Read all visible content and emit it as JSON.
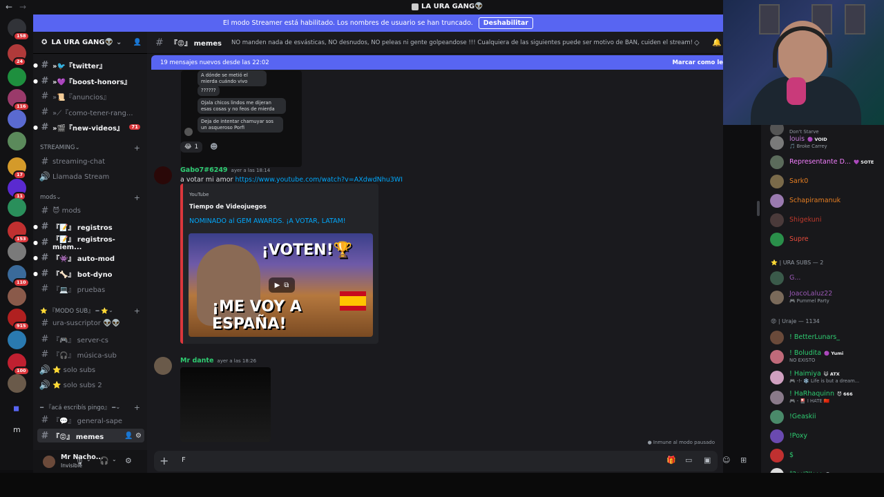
{
  "window": {
    "title": "LA URA GANG👽",
    "back": "←",
    "forward": "→"
  },
  "banner": {
    "text": "El modo Streamer está habilitado. Los nombres de usuario se han truncado.",
    "button": "Deshabilitar"
  },
  "guilds": [
    {
      "badge": "158",
      "color": "#313338"
    },
    {
      "badge": "24",
      "color": "#b03a3a"
    },
    {
      "badge": "",
      "color": "#1e8f3e"
    },
    {
      "badge": "116",
      "color": "#9a3a6a"
    },
    {
      "badge": "",
      "color": "#5a6ad0"
    },
    {
      "badge": "",
      "color": "#5b8a5b"
    },
    {
      "badge": "17",
      "color": "#d49a2a"
    },
    {
      "badge": "11",
      "color": "#5a2ad0"
    },
    {
      "badge": "",
      "color": "#2a8f5b"
    },
    {
      "badge": "153",
      "color": "#c03030"
    },
    {
      "badge": "",
      "color": "#7a7a7a"
    },
    {
      "badge": "110",
      "color": "#3a6a9a"
    },
    {
      "badge": "",
      "color": "#8a5a4a"
    },
    {
      "badge": "915",
      "color": "#b02020"
    },
    {
      "badge": "",
      "color": "#2a7ab0"
    },
    {
      "badge": "100",
      "color": "#c02030"
    },
    {
      "badge": "",
      "color": "#6a5a4a"
    }
  ],
  "guild_folder_label": "m",
  "server": {
    "name": "LA URA GANG👽"
  },
  "channels": [
    {
      "label": "»🐦『twitter』",
      "bold": true,
      "arrow": true
    },
    {
      "label": "»💜『boost-honors』",
      "bold": true,
      "arrow": true
    },
    {
      "label": "»📜『anuncios』",
      "bold": false,
      "arrow": true
    },
    {
      "label": "»⟋『como-tener-rang...",
      "bold": false,
      "arrow": true
    },
    {
      "label": "»🎬『new-videos』",
      "bold": true,
      "arrow": true,
      "badge": "71"
    }
  ],
  "cat_streaming": "STREAMING",
  "streaming": [
    {
      "label": "streaming-chat",
      "icon": "#"
    },
    {
      "label": "Llamada Stream",
      "icon": "🔊"
    }
  ],
  "cat_mods": "mods",
  "mods": [
    {
      "label": "😈 mods",
      "bold": false
    },
    {
      "label": "『📝』 registros",
      "bold": true
    },
    {
      "label": "『📝』 registros-miem...",
      "bold": true
    },
    {
      "label": "『👾』 auto-mod",
      "bold": true
    },
    {
      "label": "『🦴』 bot-dyno",
      "bold": true
    },
    {
      "label": "『💻』 pruebas",
      "bold": false
    }
  ],
  "cat_sub": "⭐ 『MODO SUB』 ━ ⭐",
  "sub": [
    {
      "label": "ura-suscriptor 👽👽",
      "icon": "#"
    },
    {
      "label": "『🎮』 server-cs",
      "icon": "#"
    },
    {
      "label": "『🎧』 música-sub",
      "icon": "#"
    },
    {
      "label": "⭐ solo subs",
      "icon": "🔊"
    },
    {
      "label": "⭐ solo subs 2",
      "icon": "🔊"
    }
  ],
  "cat_pingo": "━ 『acá escribís pingo』 ━",
  "pingo": [
    {
      "label": "『💬』 general-sape",
      "selected": false
    },
    {
      "label": "『😡』 memes",
      "selected": true
    }
  ],
  "user": {
    "name": "Mr Nacho...",
    "status": "Invisible"
  },
  "chat": {
    "channel": "『😡』 memes",
    "topic": "NO manden nada de esvásticas, NO desnudos, NO peleas ni gente golpeandose !!! Cualquiera de las siguientes puede ser motivo de BAN, cuiden el stream!",
    "new_messages": "19 mensajes nuevos desde las 22:02",
    "mark_read": "Marcar como le",
    "bubbles": [
      "A dónde se metió el mierda cuándo vivo",
      "??????",
      "Ojala chicos lindos me dijeran esas cosas y no feos de mierda",
      "Deja de intentar chamuyar sos un asqueroso Porfi"
    ],
    "reaction_count": "1",
    "msg1": {
      "author": "Gabo7#6249",
      "time": "ayer a las 18:14",
      "text": "a votar mi amor ",
      "link": "https://www.youtube.com/watch?v=AXdwdNhu3WI"
    },
    "embed": {
      "provider": "YouTube",
      "title": "Tiempo de Videojuegos",
      "link": "NOMINADO al GEM AWARDS. ¡A VOTAR, LATAM!",
      "thumb_top": "¡VOTEN!🏆",
      "thumb_bottom": "¡ME VOY A ESPAÑA!"
    },
    "msg2": {
      "author": "Mr dante",
      "time": "ayer a las 18:26"
    },
    "immune": "Inmune al modo pausado",
    "input_value": "F"
  },
  "members": {
    "top_partial": "Don't Starve",
    "group1": [
      {
        "name": "louis",
        "color": "#c27cd6",
        "tag": "🟣 VOID",
        "sub": "🎵 Broke Carrey",
        "av": "#7a7a7a"
      },
      {
        "name": "Representante D...",
        "color": "#f47fff",
        "tag": "💜 SOTE",
        "sub": "",
        "av": "#5b6b5b"
      },
      {
        "name": "Sark0",
        "color": "#e67e22",
        "tag": "",
        "sub": "",
        "av": "#7a6a4a"
      },
      {
        "name": "Schapiramanuk",
        "color": "#e67e22",
        "tag": "",
        "sub": "",
        "av": "#9a7ab0"
      },
      {
        "name": "Shigekuni",
        "color": "#c0392b",
        "tag": "",
        "sub": "",
        "av": "#4a3a3a"
      },
      {
        "name": "Supre",
        "color": "#e74c3c",
        "tag": "",
        "sub": "",
        "av": "#2a8f4a"
      }
    ],
    "cat_subs": "⭐ | URA SUBS — 2",
    "group2": [
      {
        "name": "G...",
        "color": "#9b59b6",
        "tag": "",
        "sub": "",
        "av": "#3a5a4a"
      },
      {
        "name": "JoacoLaluz22",
        "color": "#9b59b6",
        "tag": "",
        "sub": "🎮 Pummel Party",
        "av": "#7a6a5a"
      }
    ],
    "cat_uraje": "😡 | Uraje — 1134",
    "group3": [
      {
        "name": "! BetterLunars_",
        "color": "#2ecc71",
        "tag": "",
        "sub": "",
        "av": "#6a4a3a"
      },
      {
        "name": "! Boludita",
        "color": "#2ecc71",
        "tag": "🟣 Yumi",
        "sub": "NO EXISTO",
        "av": "#c06a7a"
      },
      {
        "name": "! Haimiya",
        "color": "#2ecc71",
        "tag": "😺 ATX",
        "sub": "🎮 -!- ❄️ Life is but a dream...",
        "av": "#d0a0c0"
      },
      {
        "name": "! HaRhaquinn",
        "color": "#2ecc71",
        "tag": "😈 666",
        "sub": "🎮 - 🎴 I HATE 🇨🇳",
        "av": "#8a7a8a"
      },
      {
        "name": "!Geaskii",
        "color": "#2ecc71",
        "tag": "",
        "sub": "",
        "av": "#4a8a6a"
      },
      {
        "name": "!Poxy",
        "color": "#2ecc71",
        "tag": "",
        "sub": "",
        "av": "#6a4ab0"
      },
      {
        "name": "$",
        "color": "#2ecc71",
        "tag": "",
        "sub": "",
        "av": "#c03030"
      },
      {
        "name": "°?¿¿'?''¿¿¿",
        "color": "#2ecc71",
        "tag": "💀 GI",
        "sub": "",
        "av": "#dddddd"
      }
    ]
  }
}
